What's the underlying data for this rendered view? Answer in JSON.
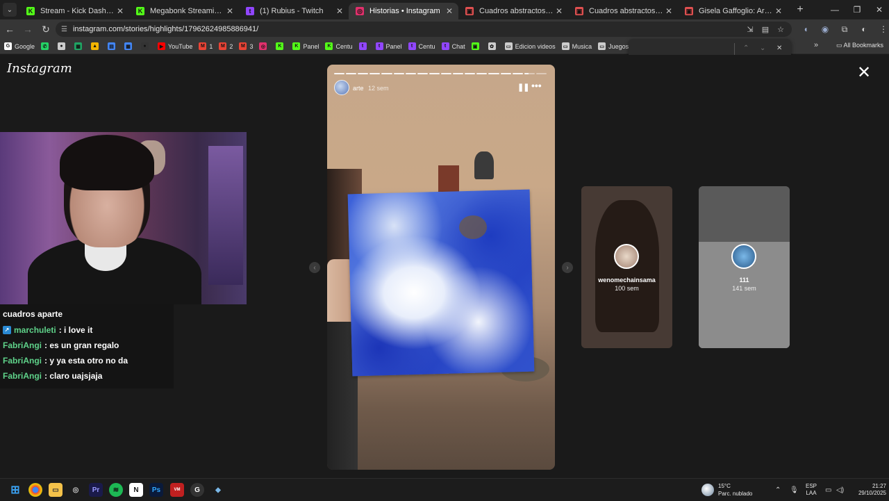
{
  "tabs": [
    {
      "label": "Stream - Kick Dashboard",
      "icon": "kick-icon",
      "color": "#53fc18",
      "glyph": "K"
    },
    {
      "label": "Megabonk Streaming - Live Str",
      "icon": "kick-icon",
      "color": "#53fc18",
      "glyph": "K"
    },
    {
      "label": "(1) Rubius - Twitch",
      "icon": "twitch-icon",
      "color": "#9146ff",
      "glyph": "t"
    },
    {
      "label": "Historias • Instagram",
      "icon": "instagram-icon",
      "color": "#e1306c",
      "glyph": "◎",
      "active": true
    },
    {
      "label": "Cuadros abstractos en venta - S",
      "icon": "shop-icon",
      "color": "#e05050",
      "glyph": "▣"
    },
    {
      "label": "Cuadros abstractos en venta - S",
      "icon": "shop-icon",
      "color": "#e05050",
      "glyph": "▣"
    },
    {
      "label": "Gisela Gaffoglio: Artista Pintor",
      "icon": "shop-icon",
      "color": "#e05050",
      "glyph": "▣"
    }
  ],
  "address": {
    "url": "instagram.com/stories/highlights/17962624985886941/"
  },
  "bookmarks": [
    {
      "label": "Google",
      "icon": "google-icon",
      "color": "#ffffff",
      "glyph": "G"
    },
    {
      "label": "",
      "icon": "whatsapp-icon",
      "color": "#25d366",
      "glyph": "✆"
    },
    {
      "label": "",
      "icon": "apple-icon",
      "color": "#cccccc",
      "glyph": "●"
    },
    {
      "label": "",
      "icon": "sheets-icon",
      "color": "#1fa463",
      "glyph": "▦"
    },
    {
      "label": "",
      "icon": "drive-icon",
      "color": "#f4b400",
      "glyph": "▲"
    },
    {
      "label": "",
      "icon": "docs-icon",
      "color": "#4285f4",
      "glyph": "▤"
    },
    {
      "label": "",
      "icon": "calendar-icon",
      "color": "#4285f4",
      "glyph": "▦"
    },
    {
      "label": "",
      "icon": "circle-icon",
      "color": "#333333",
      "glyph": "●"
    },
    {
      "label": "YouTube",
      "icon": "youtube-icon",
      "color": "#ff0000",
      "glyph": "▶"
    },
    {
      "label": "1",
      "icon": "gmail-icon",
      "color": "#ea4335",
      "glyph": "M"
    },
    {
      "label": "2",
      "icon": "gmail-icon",
      "color": "#ea4335",
      "glyph": "M"
    },
    {
      "label": "3",
      "icon": "gmail-icon",
      "color": "#ea4335",
      "glyph": "M"
    },
    {
      "label": "",
      "icon": "instagram-icon",
      "color": "#e1306c",
      "glyph": "◎"
    },
    {
      "label": "",
      "icon": "kick-icon",
      "color": "#53fc18",
      "glyph": "K"
    },
    {
      "label": "Panel",
      "icon": "kick-icon",
      "color": "#53fc18",
      "glyph": "K"
    },
    {
      "label": "Centu",
      "icon": "kick-icon",
      "color": "#53fc18",
      "glyph": "K"
    },
    {
      "label": "",
      "icon": "twitch-icon",
      "color": "#9146ff",
      "glyph": "t"
    },
    {
      "label": "Panel",
      "icon": "twitch-icon",
      "color": "#9146ff",
      "glyph": "t"
    },
    {
      "label": "Centu",
      "icon": "twitch-icon",
      "color": "#9146ff",
      "glyph": "t"
    },
    {
      "label": "Chat",
      "icon": "twitch-icon",
      "color": "#9146ff",
      "glyph": "t"
    },
    {
      "label": "",
      "icon": "app-icon",
      "color": "#53fc18",
      "glyph": "▣"
    },
    {
      "label": "",
      "icon": "extension-icon",
      "color": "#cccccc",
      "glyph": "✿"
    },
    {
      "label": "Edicion videos",
      "icon": "folder-icon",
      "color": "#cccccc",
      "glyph": "▭"
    },
    {
      "label": "Musica",
      "icon": "folder-icon",
      "color": "#cccccc",
      "glyph": "▭"
    },
    {
      "label": "Juegos Random",
      "icon": "folder-icon",
      "color": "#cccccc",
      "glyph": "▭"
    }
  ],
  "bookmarks_all": "All Bookmarks",
  "instagram": {
    "logo": "Instagram",
    "story": {
      "username": "arte",
      "time": "12 sem",
      "segments_total": 18,
      "segments_done": 16
    },
    "previews": [
      {
        "name": "wenomechainsama",
        "time": "100 sem",
        "bg": "#6e5a50"
      },
      {
        "name": "111",
        "time": "141 sem",
        "bg": "#8a8a8a"
      }
    ]
  },
  "stream": {
    "chat_title": "cuadros aparte",
    "messages": [
      {
        "user": "marchuleti",
        "text": ": i love it",
        "badge": true
      },
      {
        "user": "FabriAngi",
        "text": ": es un gran regalo",
        "badge": false
      },
      {
        "user": "FabriAngi",
        "text": ": y ya esta otro no da",
        "badge": false
      },
      {
        "user": "FabriAngi",
        "text": ": claro uajsjaja",
        "badge": false
      }
    ]
  },
  "taskbar": {
    "weather_temp": "15°C",
    "weather_desc": "Parc. nublado",
    "lang_top": "ESP",
    "lang_bottom": "LAA",
    "time": "21:27",
    "date": "29/10/2025"
  }
}
